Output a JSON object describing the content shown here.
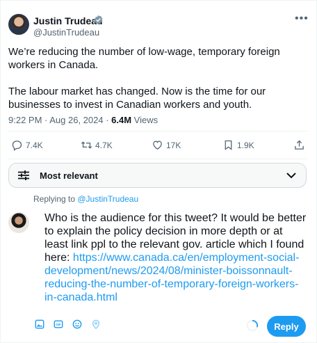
{
  "author": {
    "name": "Justin Trudeau",
    "handle": "@JustinTrudeau"
  },
  "tweet": {
    "paragraph_1": "We’re reducing the number of low-wage, temporary foreign workers in Canada.",
    "paragraph_2": "The labour market has changed. Now is the time for our businesses to invest in Canadian workers and youth.",
    "timestamp": "9:22 PM · Aug 26, 2024 · ",
    "views_count": "6.4M",
    "views_label": " Views"
  },
  "actions": {
    "replies": "7.4K",
    "reposts": "4.7K",
    "likes": "17K",
    "bookmarks": "1.9K"
  },
  "sort": {
    "label": "Most relevant"
  },
  "reply": {
    "replying_prefix": "Replying to ",
    "replying_handle": "@JustinTrudeau",
    "text": "Who is the audience for this tweet? It would be better to explain the policy decision in more depth or at least link ppl to the relevant gov. article which I found here: ",
    "link": "https://www.canada.ca/en/employment-social-development/news/2024/08/minister-boissonnault-reducing-the-number-of-temporary-foreign-workers-in-canada.html",
    "button_label": "Reply"
  },
  "colors": {
    "accent": "#1d9bf0",
    "text": "#0f1419",
    "muted": "#536471"
  },
  "icons": [
    "verified-badge-icon",
    "more-icon",
    "reply-icon",
    "repost-icon",
    "like-icon",
    "bookmark-icon",
    "share-icon",
    "sort-icon",
    "chevron-down-icon",
    "image-icon",
    "gif-icon",
    "emoji-icon",
    "location-icon",
    "character-count-icon"
  ]
}
